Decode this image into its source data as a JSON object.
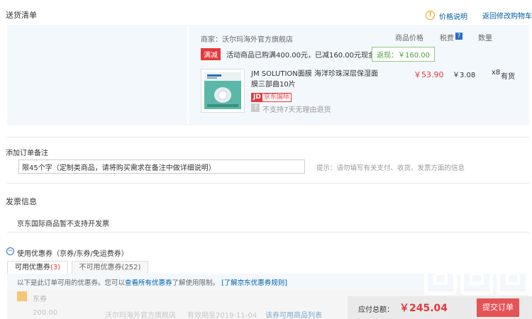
{
  "delivery": {
    "title": "送货清单",
    "price_help": "价格说明",
    "back_cart": "返回修改购物车",
    "info_glyph": "!"
  },
  "shop": {
    "label": "商家：沃尔玛海外官方旗舰店"
  },
  "headers": {
    "price": "商品价格",
    "tax": "税费",
    "tax_help": "?",
    "qty": "数量"
  },
  "promo": {
    "tag": "满减",
    "text": "活动商品已购满400.00元，已减160.00元现金",
    "rebate": "返现：￥160.00"
  },
  "product": {
    "name": "JM SOLUTION面膜 海洋珍珠深层保湿面膜三部曲10片",
    "price": "￥53.90",
    "tax": "￥3.08",
    "qty": "x8",
    "stock": "有货",
    "jd_label": "JD",
    "jd_text": "京东国际",
    "no_return": "不支持7天无理由退货",
    "no_return_glyph": "7"
  },
  "remark": {
    "title": "添加订单备注",
    "value": "限45个字（定制类商品，请将购买需求在备注中做详细说明）",
    "hint": "提示：请勿填写有关支付、收货、发票方面的信息"
  },
  "invoice": {
    "title": "发票信息",
    "text": "京东国际商品暂不支持开发票"
  },
  "coupon": {
    "toggle_glyph": "−",
    "title": "使用优惠券（京券/东券/免运费券）",
    "tab_available": "可用优惠券",
    "tab_available_count": "(3)",
    "tab_unavailable": "不可用优惠券",
    "tab_unavailable_count": "(252)",
    "info_prefix": "以下是此订单可用的优惠券。您可以",
    "info_link": "查看所有优惠券",
    "info_suffix": "了解使用限制。",
    "rules_link": "[了解京东优惠券规则]",
    "row_type": "东券",
    "row_amount": "200.00",
    "row_shop": "沃尔玛海外官方旗舰店",
    "row_expiry": "有效期至2019-11-04",
    "row_link": "该券可用商品列表"
  },
  "footer": {
    "total_label": "应付总额：",
    "total_value": "￥245.04",
    "submit": "提交订单"
  },
  "colors": {
    "accent": "#e4393c",
    "link": "#005ea7",
    "panel": "#f3f8fd"
  }
}
